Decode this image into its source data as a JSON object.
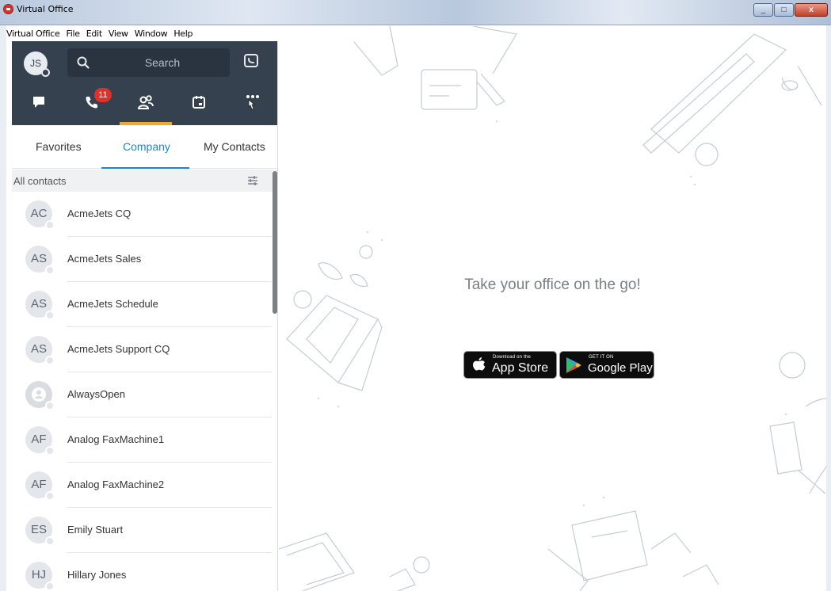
{
  "window": {
    "title": "Virtual Office",
    "min": "_",
    "max": "□",
    "close": "x"
  },
  "menu": [
    "Virtual Office",
    "File",
    "Edit",
    "View",
    "Window",
    "Help"
  ],
  "user": {
    "initials": "JS"
  },
  "search": {
    "placeholder": "Search"
  },
  "nav": {
    "missed_calls_badge": "11",
    "active_tab": "contacts"
  },
  "subtabs": {
    "favorites": "Favorites",
    "company": "Company",
    "my_contacts": "My Contacts"
  },
  "contacts_header": "All contacts",
  "contacts": [
    {
      "initials": "AC",
      "name": "AcmeJets CQ"
    },
    {
      "initials": "AS",
      "name": "AcmeJets Sales"
    },
    {
      "initials": "AS",
      "name": "AcmeJets Schedule"
    },
    {
      "initials": "AS",
      "name": "AcmeJets Support CQ"
    },
    {
      "initials": "",
      "name": "AlwaysOpen"
    },
    {
      "initials": "AF",
      "name": "Analog FaxMachine1"
    },
    {
      "initials": "AF",
      "name": "Analog FaxMachine2"
    },
    {
      "initials": "ES",
      "name": "Emily Stuart"
    },
    {
      "initials": "HJ",
      "name": "Hillary Jones"
    }
  ],
  "promo": {
    "tagline": "Take your office on the go!",
    "appstore_small": "Download on the",
    "appstore_big": "App Store",
    "googleplay_small": "GET IT ON",
    "googleplay_big": "Google Play"
  },
  "colors": {
    "nav_bg": "#35414f",
    "accent_blue": "#1d86c7",
    "accent_orange": "#f0a92e",
    "badge_red": "#e0302a"
  }
}
